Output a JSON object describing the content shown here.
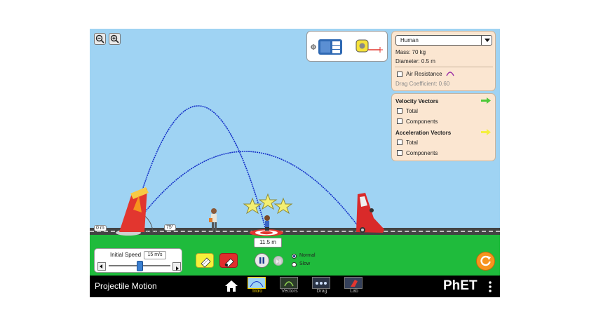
{
  "app": {
    "title": "Projectile Motion",
    "brand": "PhET"
  },
  "zoom": {
    "out_icon": "zoom-out-icon",
    "in_icon": "zoom-in-icon"
  },
  "scene": {
    "height_label": "0 m",
    "angle_label": "75°",
    "range_label": "11.5 m",
    "stars_count": 3,
    "colors": {
      "sky": "#9fd3f3",
      "ground": "#1fbb3c",
      "trajectory": "#1531c8",
      "accent": "#f7941d"
    }
  },
  "tools": {
    "stopwatch_icon": "stopwatch-icon",
    "tape_icon": "measuring-tape-icon"
  },
  "projectile_panel": {
    "selected": "Human",
    "mass": "Mass: 70 kg",
    "diameter": "Diameter: 0.5 m",
    "air_resistance": "Air Resistance",
    "drag": "Drag Coefficient: 0.60"
  },
  "vectors_panel": {
    "velocity_title": "Velocity Vectors",
    "velocity_total": "Total",
    "velocity_components": "Components",
    "accel_title": "Acceleration Vectors",
    "accel_total": "Total",
    "accel_components": "Components"
  },
  "speed": {
    "label": "Initial Speed",
    "value": "15 m/s",
    "fraction": 0.5
  },
  "speed_mode": {
    "normal": "Normal",
    "slow": "Slow",
    "selected": "Normal"
  },
  "tabs": [
    {
      "label": "Intro",
      "selected": true
    },
    {
      "label": "Vectors",
      "selected": false
    },
    {
      "label": "Drag",
      "selected": false
    },
    {
      "label": "Lab",
      "selected": false
    }
  ]
}
